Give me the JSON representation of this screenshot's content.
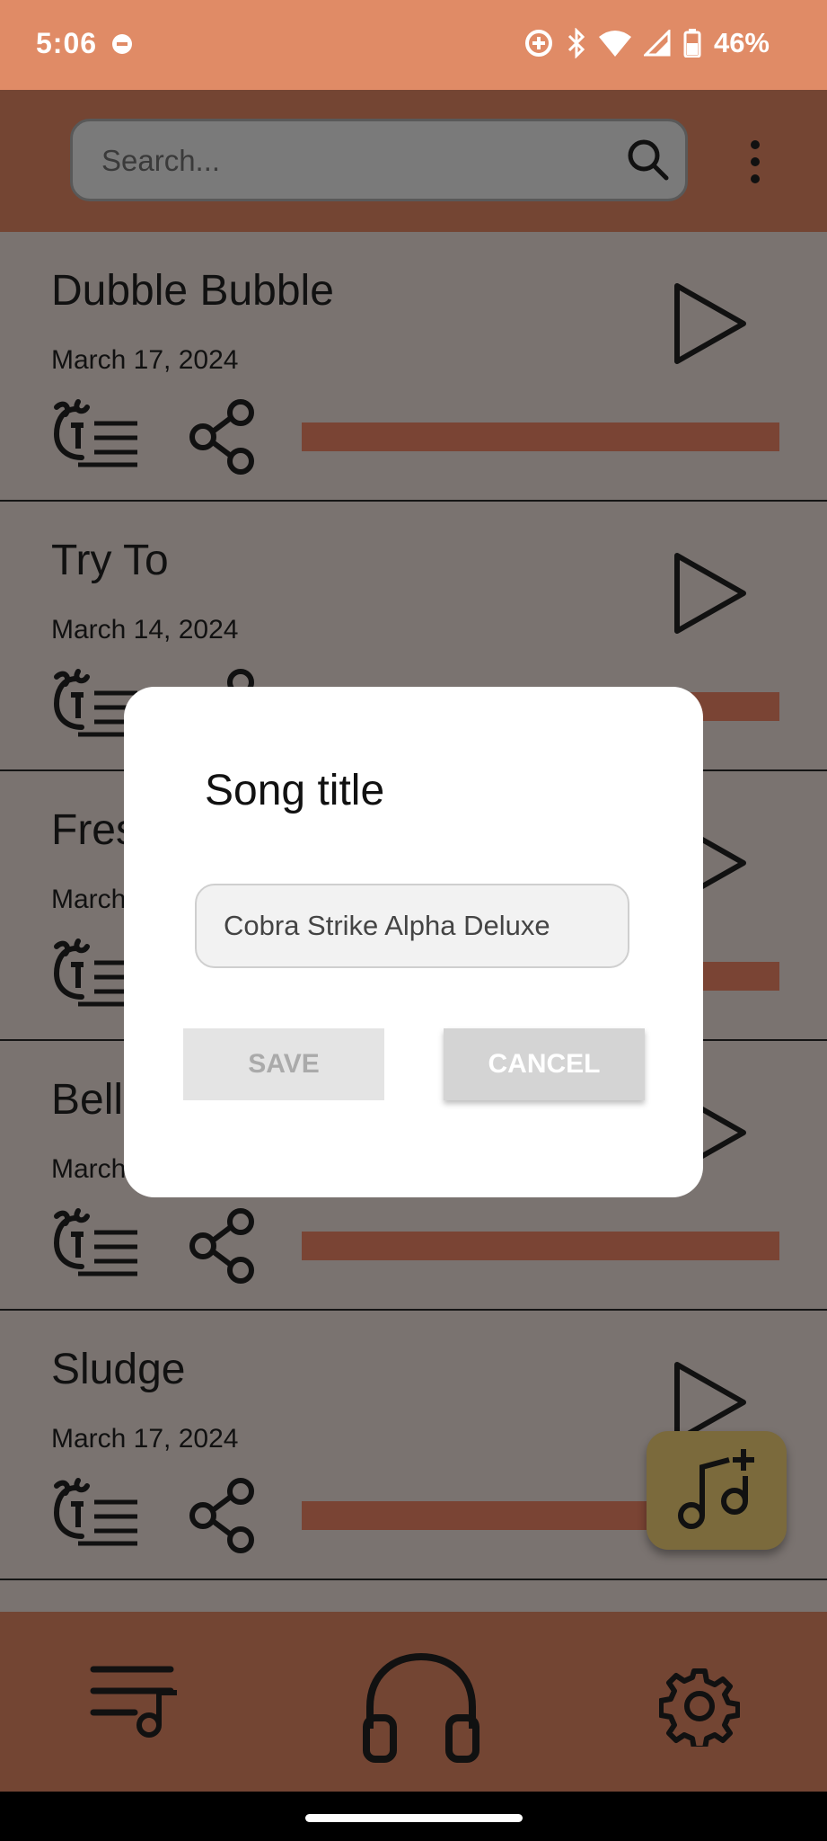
{
  "status_bar": {
    "time": "5:06",
    "battery": "46%"
  },
  "search": {
    "placeholder": "Search..."
  },
  "songs": [
    {
      "title": "Dubble Bubble",
      "date": "March 17, 2024"
    },
    {
      "title": "Try To",
      "date": "March 14, 2024"
    },
    {
      "title": "Fres",
      "date": "March"
    },
    {
      "title": "Bell",
      "date": "March"
    },
    {
      "title": "Sludge",
      "date": "March 17, 2024"
    }
  ],
  "dialog": {
    "title": "Song title",
    "input_value": "Cobra Strike Alpha Deluxe",
    "save_label": "SAVE",
    "cancel_label": "CANCEL"
  },
  "icons": {
    "play": "play-icon",
    "lyrics": "lyrics-icon",
    "share": "share-icon",
    "search": "search-icon",
    "menu": "more-vert-icon",
    "add_song": "add-music-icon",
    "library": "playlist-icon",
    "player": "headphones-icon",
    "settings": "gear-icon"
  },
  "colors": {
    "status_bar": "#e08b66",
    "app_bar": "#744533",
    "progress": "#7a4434",
    "fab": "#7b6a3c",
    "scrim_bg": "#7a7370"
  }
}
